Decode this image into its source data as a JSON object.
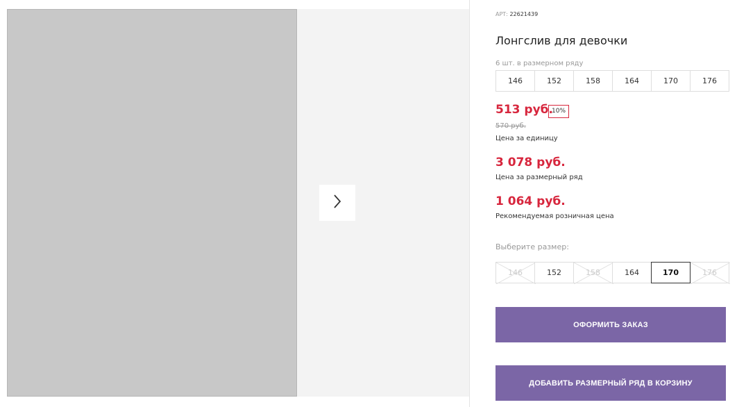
{
  "product": {
    "article_label": "АРТ:",
    "article_number": "22621439",
    "title": "Лонгслив для девочки",
    "pack_text": "6 шт. в размерном ряду"
  },
  "size_grid": [
    "146",
    "152",
    "158",
    "164",
    "170",
    "176"
  ],
  "prices": {
    "main": "513 руб.",
    "discount": "10%",
    "old": "570 руб.",
    "unit_label": "Цена за единицу",
    "set_price": "3 078 руб.",
    "set_label": "Цена за размерный ряд",
    "retail_price": "1 064 руб.",
    "retail_label": "Рекомендуемая розничная цена"
  },
  "size_select": {
    "label": "Выберите размер:",
    "options": [
      {
        "size": "146",
        "available": false
      },
      {
        "size": "152",
        "available": true
      },
      {
        "size": "158",
        "available": false
      },
      {
        "size": "164",
        "available": true
      },
      {
        "size": "170",
        "available": true,
        "selected": true
      },
      {
        "size": "176",
        "available": false
      }
    ]
  },
  "buttons": {
    "order": "ОФОРМИТЬ ЗАКАЗ",
    "add_set": "ДОБАВИТЬ РАЗМЕРНЫЙ РЯД В КОРЗИНУ"
  },
  "colors": {
    "price_red": "#d7263d",
    "button_purple": "#7b66a6"
  },
  "icons": {
    "next": "chevron-right-icon",
    "unavailable": "cross-out-icon"
  }
}
